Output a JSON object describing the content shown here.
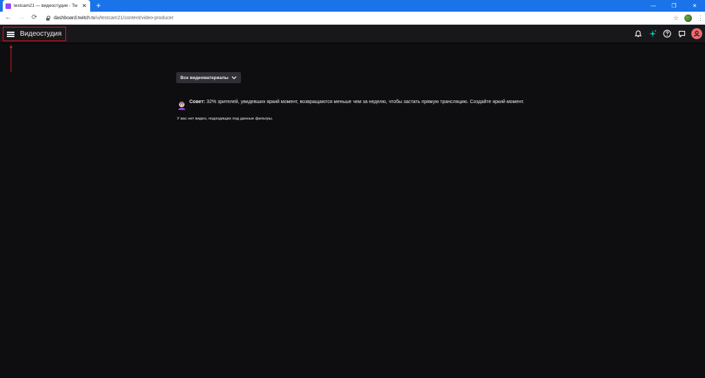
{
  "browser": {
    "tab_title": "testcam21 — видеостудия - Tw",
    "tab_close": "✕",
    "new_tab": "+",
    "url_host": "dashboard.twitch.tv",
    "url_path": "/u/testcam21/content/video-producer",
    "back": "←",
    "forward": "→",
    "reload": "⟳",
    "star": "☆",
    "menu": "⋮",
    "win_minimize": "—",
    "win_restore": "❐",
    "win_close": "✕"
  },
  "topbar": {
    "studio_title": "Видеостудия"
  },
  "main": {
    "filter_label": "Все видеоматериалы",
    "tip_label": "Совет:",
    "tip_text": " 32% зрителей, увидевших яркий момент, возвращаются меньше чем за неделю, чтобы застать прямую трансляцию. Создайте яркий момент.",
    "empty_message": "У вас нет видео, подходящих под данные фильтры."
  },
  "colors": {
    "background": "#0e0e10",
    "topbar": "#18181b",
    "accent": "#9146ff",
    "highlight_box": "#e0141e",
    "avatar": "#eb6a6f"
  },
  "icons": [
    "menu-icon",
    "bell-icon",
    "sparkle-icon",
    "help-icon",
    "chat-icon",
    "user-avatar-icon",
    "chevron-down-icon",
    "tip-mascot-icon"
  ]
}
